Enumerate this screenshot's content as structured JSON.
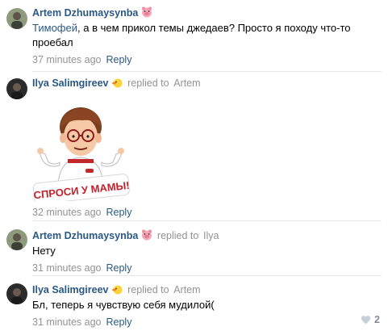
{
  "comments": [
    {
      "author": "Artem Dzhumaysynba",
      "author_emoji": "pig-emoji",
      "replied_to": "",
      "mention": "Тимофей",
      "text_after_mention": ", а в чем прикол темы джедаев? Просто я походу что-то",
      "text_line2": "проебал",
      "time": "37 minutes ago",
      "reply_label": "Reply"
    },
    {
      "author": "Ilya Salimgireev",
      "author_emoji": "duck-emoji",
      "replied_prefix": "replied to",
      "replied_to": "Artem",
      "sticker_text": "СПРОСИ У МАМЫ!",
      "time": "32 minutes ago",
      "reply_label": "Reply"
    },
    {
      "author": "Artem Dzhumaysynba",
      "author_emoji": "pig-emoji",
      "replied_prefix": "replied to",
      "replied_to": "Ilya",
      "text": "Нету",
      "time": "31 minutes ago",
      "reply_label": "Reply"
    },
    {
      "author": "Ilya Salimgireev",
      "author_emoji": "duck-emoji",
      "replied_prefix": "replied to",
      "replied_to": "Artem",
      "text": "Бл, теперь я чувствую себя мудилой(",
      "time": "31 minutes ago",
      "reply_label": "Reply",
      "likes": "2"
    }
  ],
  "colors": {
    "link": "#2a5885",
    "muted": "#939393",
    "separator": "#e7e8ec"
  }
}
